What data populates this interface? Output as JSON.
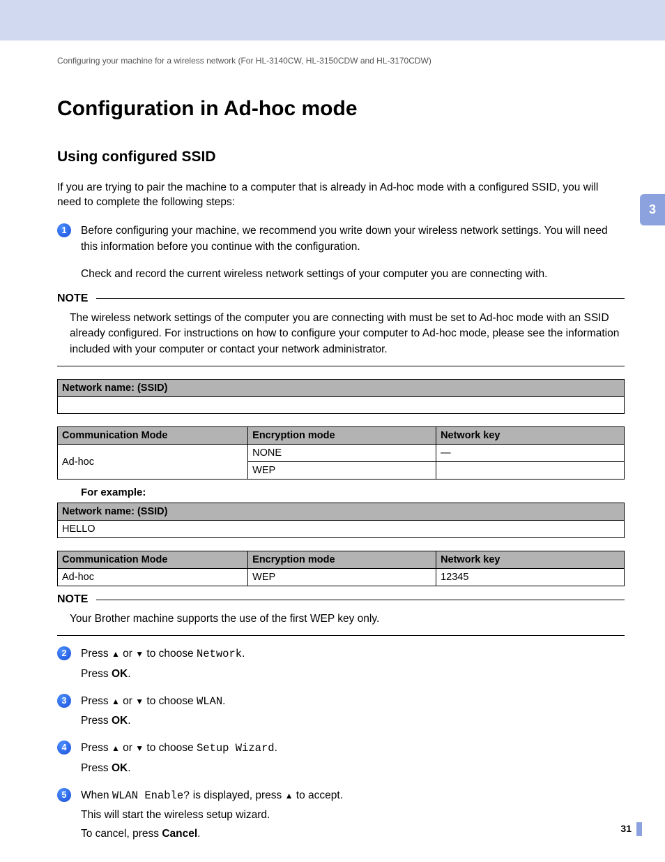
{
  "breadcrumb": "Configuring your machine for a wireless network (For HL-3140CW, HL-3150CDW and HL-3170CDW)",
  "chapterTab": "3",
  "pageNumber": "31",
  "h1": "Configuration in Ad-hoc mode",
  "h2": "Using configured SSID",
  "intro": "If you are trying to pair the machine to a computer that is already in Ad-hoc mode with a configured SSID, you will need to complete the following steps:",
  "step1": {
    "num": "1",
    "line1": "Before configuring your machine, we recommend you write down your wireless network settings. You will need this information before you continue with the configuration.",
    "line2": "Check and record the current wireless network settings of your computer you are connecting with."
  },
  "note1": {
    "label": "NOTE",
    "body": "The wireless network settings of the computer you are connecting with must be set to Ad-hoc mode with an SSID already configured. For instructions on how to configure your computer to Ad-hoc mode, please see the information included with your computer or contact your network administrator."
  },
  "tableA": {
    "header": "Network name: (SSID)",
    "blank": ""
  },
  "tableB": {
    "h1": "Communication Mode",
    "h2": "Encryption mode",
    "h3": "Network key",
    "r1c1": "Ad-hoc",
    "r1c2": "NONE",
    "r1c3": "—",
    "r2c2": "WEP",
    "r2c3": ""
  },
  "forExample": "For example:",
  "tableC": {
    "header": "Network name: (SSID)",
    "value": "HELLO"
  },
  "tableD": {
    "h1": "Communication Mode",
    "h2": "Encryption mode",
    "h3": "Network key",
    "r1c1": "Ad-hoc",
    "r1c2": "WEP",
    "r1c3": "12345"
  },
  "note2": {
    "label": "NOTE",
    "body": "Your Brother machine supports the use of the first WEP key only."
  },
  "step2": {
    "num": "2",
    "pre": "Press ",
    "or": " or ",
    "post": " to choose ",
    "sel": "Network",
    "dot": ".",
    "ok1": "Press ",
    "ok2": "OK",
    "ok3": "."
  },
  "step3": {
    "num": "3",
    "pre": "Press ",
    "or": " or ",
    "post": " to choose ",
    "sel": "WLAN",
    "dot": ".",
    "ok1": "Press ",
    "ok2": "OK",
    "ok3": "."
  },
  "step4": {
    "num": "4",
    "pre": "Press ",
    "or": " or ",
    "post": " to choose ",
    "sel": "Setup Wizard",
    "dot": ".",
    "ok1": "Press ",
    "ok2": "OK",
    "ok3": "."
  },
  "step5": {
    "num": "5",
    "pre": "When ",
    "sel": "WLAN Enable?",
    "mid": " is displayed, press ",
    "post": " to accept.",
    "l2": "This will start the wireless setup wizard.",
    "l3a": "To cancel, press ",
    "l3b": "Cancel",
    "l3c": "."
  },
  "glyph": {
    "up": "▲",
    "down": "▼"
  }
}
